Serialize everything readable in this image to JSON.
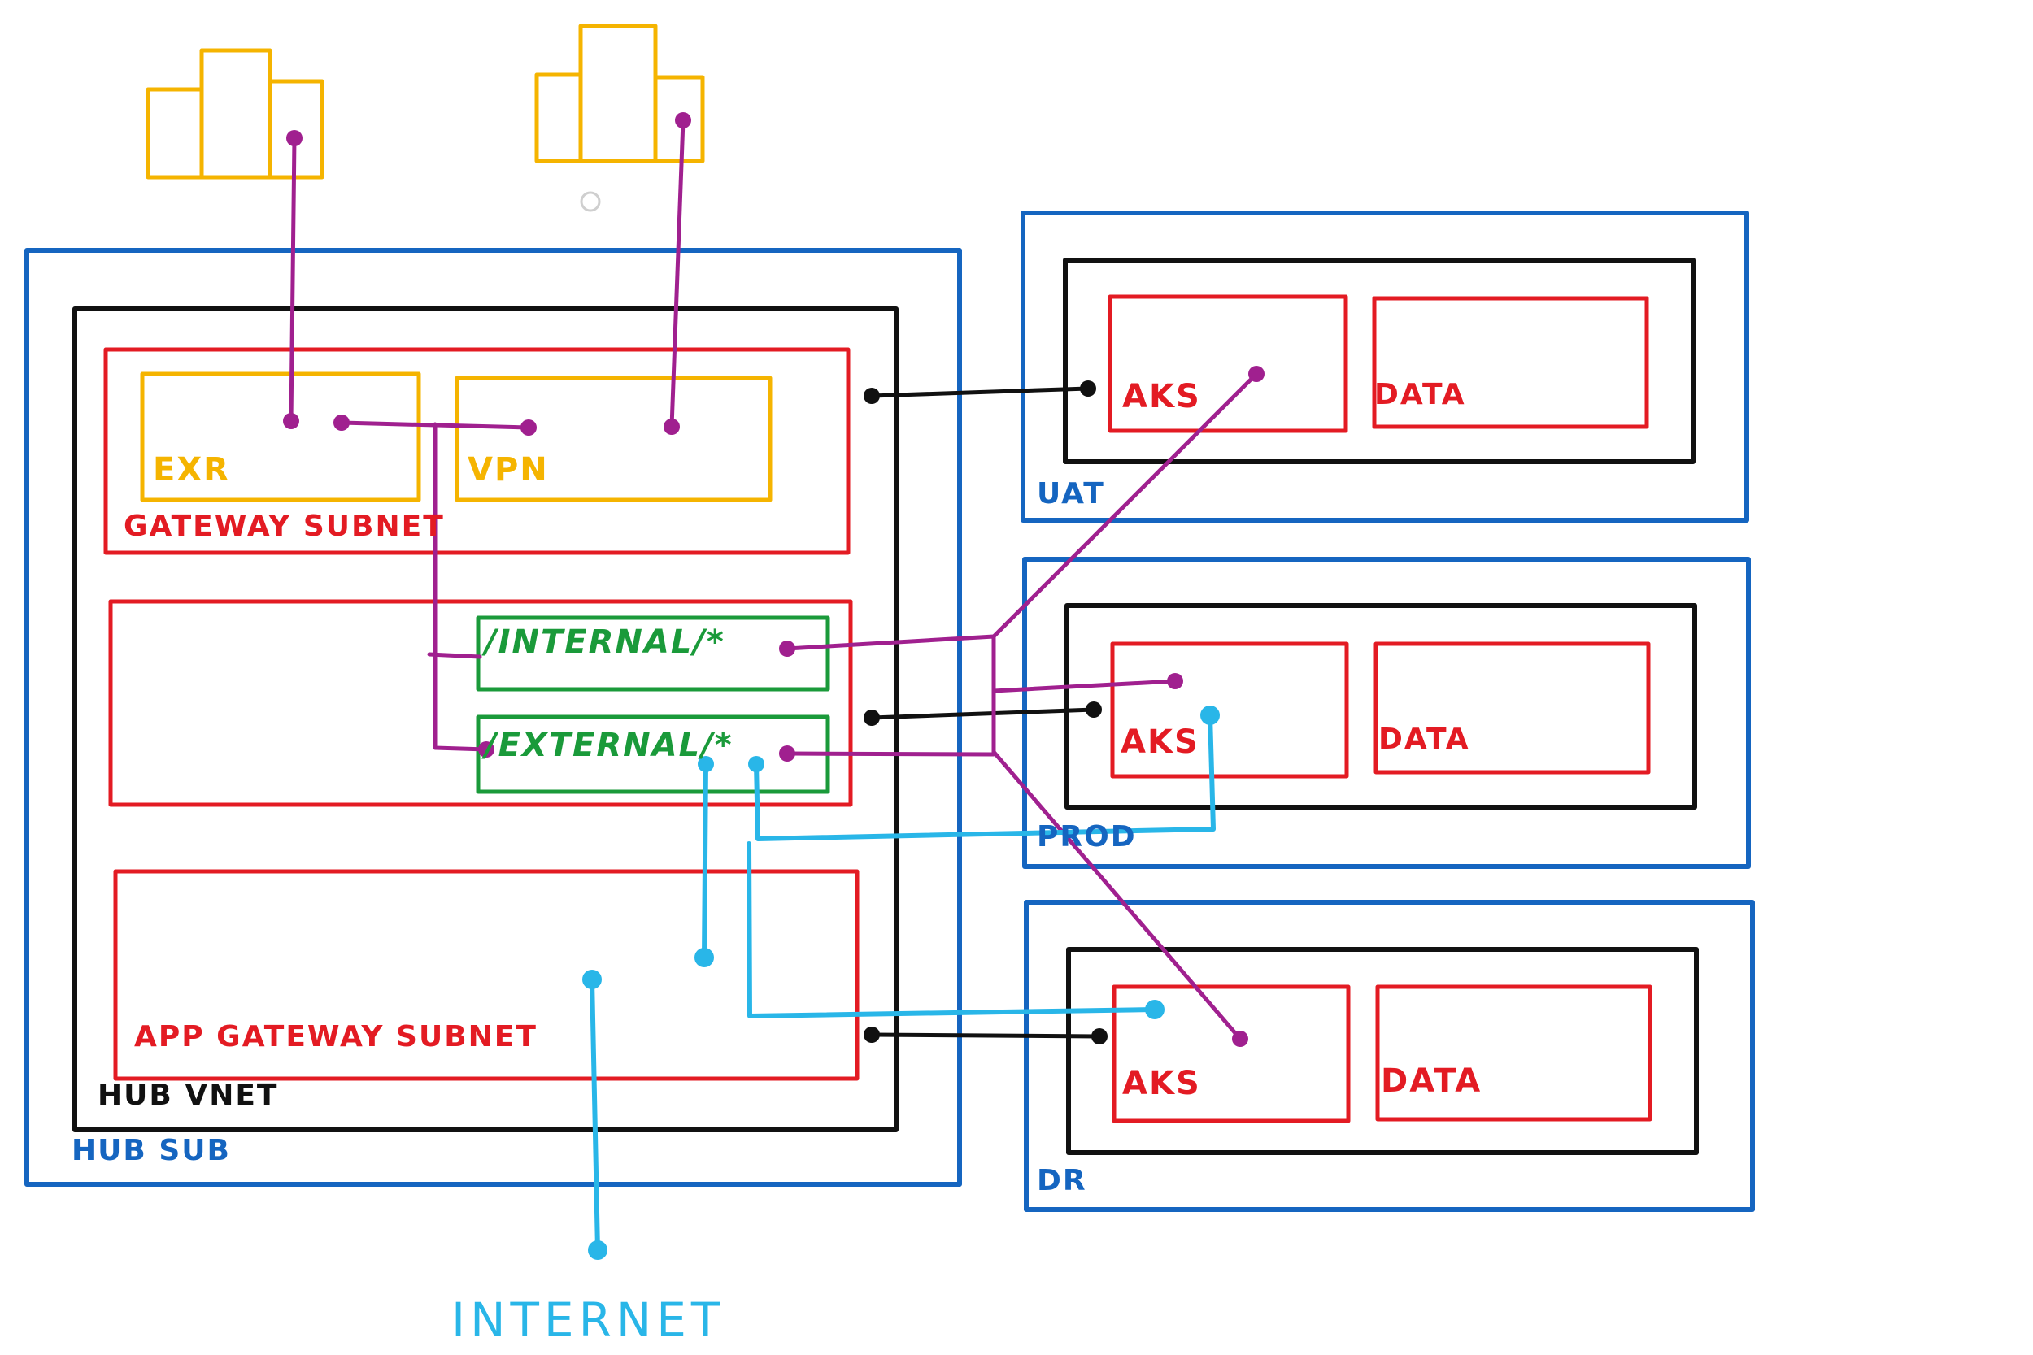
{
  "colors": {
    "blue": "#1565c0",
    "black": "#111111",
    "red": "#e31b23",
    "yellow": "#f5b400",
    "green": "#1a9a3a",
    "purple": "#a0208f",
    "cyan": "#29b6e8"
  },
  "icons": {
    "datacenter_left": "building-icon",
    "datacenter_right": "building-icon"
  },
  "hub": {
    "subscription_label": "HUB SUB",
    "vnet_label": "HUB VNET",
    "gateway_subnet_label": "GATEWAY SUBNET",
    "exr_label": "EXR",
    "vpn_label": "VPN",
    "internal_route_label": "/INTERNAL/*",
    "external_route_label": "/EXTERNAL/*",
    "app_gateway_subnet_label": "APP GATEWAY SUBNET"
  },
  "environments": {
    "uat": {
      "label": "UAT",
      "aks_label": "AKS",
      "data_label": "DATA"
    },
    "prod": {
      "label": "PROD",
      "aks_label": "AKS",
      "data_label": "DATA"
    },
    "dr": {
      "label": "DR",
      "aks_label": "AKS",
      "data_label": "DATA"
    }
  },
  "internet_label": "INTERNET"
}
